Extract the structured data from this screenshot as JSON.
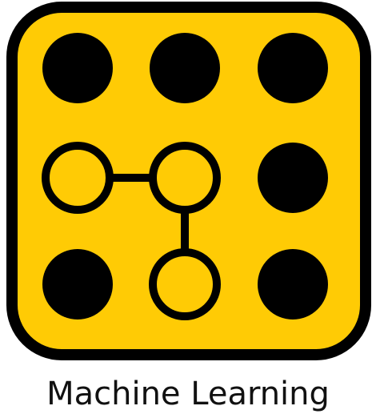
{
  "caption": "Machine Learning",
  "colors": {
    "tile_fill": "#FFCB05",
    "ink": "#000000",
    "background": "#FFFFFF"
  },
  "icon": {
    "name": "neural-network-grid-icon",
    "grid": {
      "rows": 3,
      "columns": 3,
      "outlined_nodes": [
        {
          "row": 2,
          "column": 1
        },
        {
          "row": 2,
          "column": 2
        },
        {
          "row": 3,
          "column": 2
        }
      ],
      "connections": [
        {
          "from": {
            "row": 2,
            "column": 1
          },
          "to": {
            "row": 2,
            "column": 2
          }
        },
        {
          "from": {
            "row": 2,
            "column": 2
          },
          "to": {
            "row": 3,
            "column": 2
          }
        }
      ]
    }
  }
}
